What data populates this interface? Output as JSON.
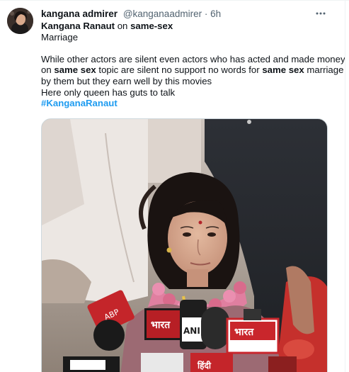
{
  "tweet": {
    "author_name": "kangana admirer",
    "author_handle": "@kanganaadmirer",
    "separator": "·",
    "timestamp": "6h",
    "more_icon": "ellipsis-icon",
    "text": {
      "line1_bold": "Kangana Ranaut",
      "line1_mid": " on ",
      "line1_bold2": "same-sex",
      "line2": "Marriage",
      "line3": "While other actors are silent even actors who has acted and made money",
      "line4_a": "on ",
      "line4_bold": "same sex",
      "line4_b": " topic are silent no support no words for ",
      "line4_bold2": "same sex",
      "line4_c": " marriage",
      "line5": "by them but they earn well by this movies",
      "line6": "Here only queen has guts to talk",
      "hashtag": "#KanganaRanaut"
    },
    "media": {
      "mic_labels": [
        "भारत",
        "ANI",
        "भारत",
        "हिंदी"
      ]
    }
  }
}
